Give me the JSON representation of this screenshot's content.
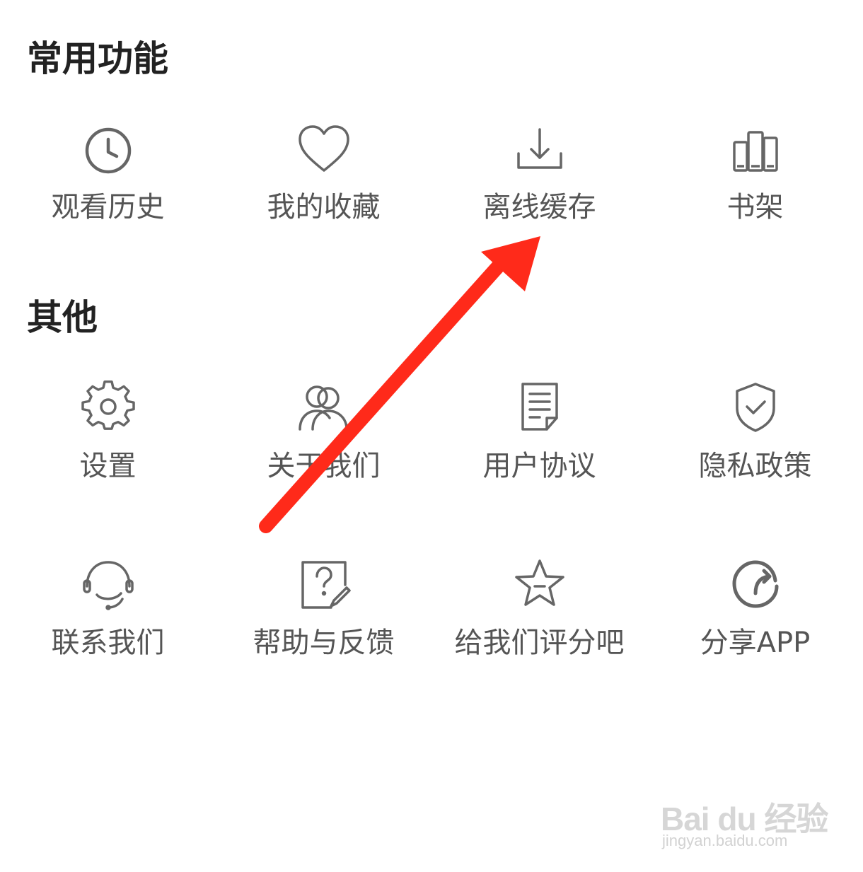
{
  "sections": {
    "common": {
      "title": "常用功能",
      "items": [
        {
          "label": "观看历史",
          "icon": "clock-icon"
        },
        {
          "label": "我的收藏",
          "icon": "heart-icon"
        },
        {
          "label": "离线缓存",
          "icon": "download-icon"
        },
        {
          "label": "书架",
          "icon": "bookshelf-icon"
        }
      ]
    },
    "other": {
      "title": "其他",
      "items": [
        {
          "label": "设置",
          "icon": "gear-icon"
        },
        {
          "label": "关于我们",
          "icon": "users-icon"
        },
        {
          "label": "用户协议",
          "icon": "document-icon"
        },
        {
          "label": "隐私政策",
          "icon": "shield-check-icon"
        },
        {
          "label": "联系我们",
          "icon": "headset-icon"
        },
        {
          "label": "帮助与反馈",
          "icon": "help-edit-icon"
        },
        {
          "label": "给我们评分吧",
          "icon": "star-icon"
        },
        {
          "label": "分享APP",
          "icon": "share-rotate-icon"
        }
      ]
    }
  },
  "colors": {
    "icon_stroke": "#666666",
    "label_text": "#555555",
    "section_title": "#222222",
    "annotation_arrow": "#ff2a1a",
    "background": "#ffffff"
  },
  "watermark": {
    "logo_text": "Bai du 经验",
    "url": "jingyan.baidu.com"
  }
}
